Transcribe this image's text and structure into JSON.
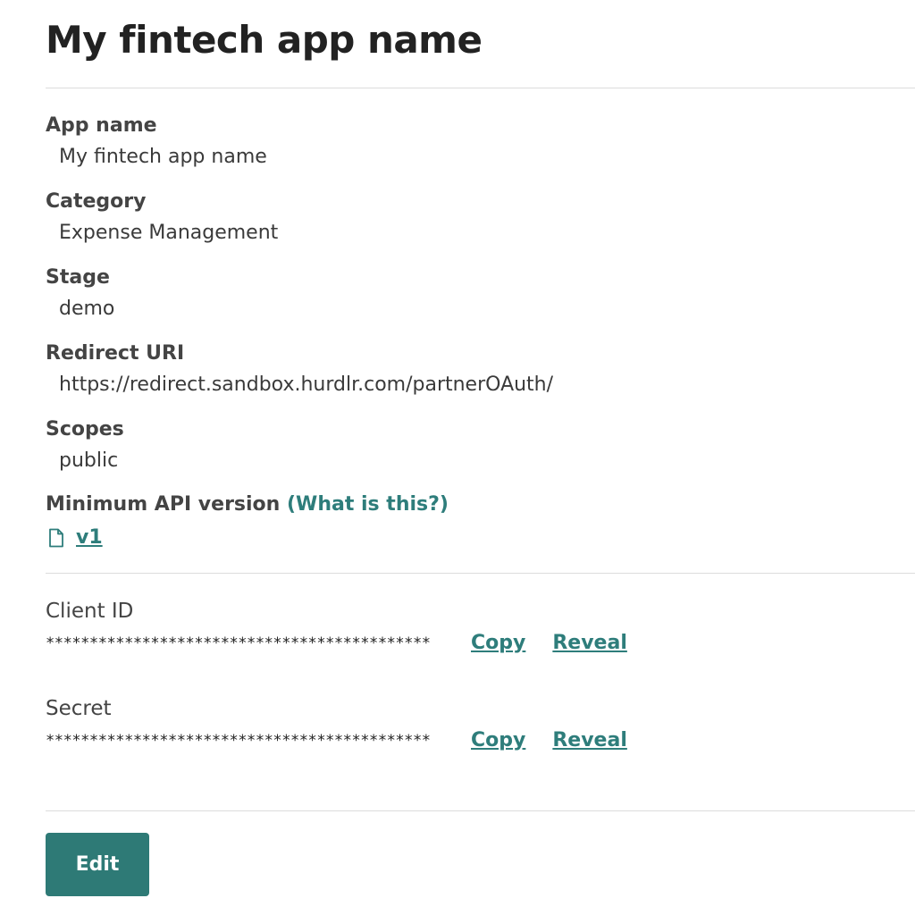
{
  "page": {
    "title": "My fintech app name"
  },
  "details": {
    "app_name": {
      "label": "App name",
      "value": "My fintech app name"
    },
    "category": {
      "label": "Category",
      "value": "Expense Management"
    },
    "stage": {
      "label": "Stage",
      "value": "demo"
    },
    "redirect_uri": {
      "label": "Redirect URI",
      "value": "https://redirect.sandbox.hurdlr.com/partnerOAuth/"
    },
    "scopes": {
      "label": "Scopes",
      "value": "public"
    },
    "min_api_version": {
      "label": "Minimum API version",
      "help_link": "(What is this?)",
      "value": "v1",
      "icon": "document-icon"
    }
  },
  "credentials": {
    "client_id": {
      "label": "Client ID",
      "masked_value": "********************************************",
      "copy_label": "Copy",
      "reveal_label": "Reveal"
    },
    "secret": {
      "label": "Secret",
      "masked_value": "********************************************",
      "copy_label": "Copy",
      "reveal_label": "Reveal"
    }
  },
  "actions": {
    "edit_label": "Edit"
  },
  "colors": {
    "accent": "#2e7d7b",
    "button_bg": "#2e7a76",
    "divider": "#dcdcdc"
  }
}
